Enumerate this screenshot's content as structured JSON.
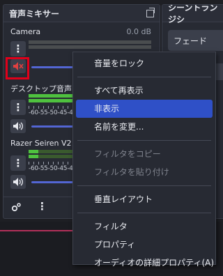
{
  "mixer": {
    "title": "音声ミキサー",
    "channels": [
      {
        "name": "Camera",
        "db": "0.0 dB",
        "muted": true,
        "meter_level": 0.0,
        "volume": 1.0
      },
      {
        "name": "デスクトップ音声",
        "db": "",
        "muted": false,
        "meter_level": 0.55,
        "volume": 1.0,
        "scale": "-60-55-50-45-40"
      },
      {
        "name": "Razer Seiren V2 P",
        "db": "",
        "muted": false,
        "meter_level": 0.08,
        "volume": 1.0,
        "scale": "-60-55-50-45-40"
      }
    ],
    "kebab_glyph": "⋮"
  },
  "transitions": {
    "title": "シーントランジシ",
    "selected": "フェード"
  },
  "context_menu": {
    "items": [
      {
        "label": "音量をロック",
        "enabled": true
      },
      {
        "label": "すべて再表示",
        "enabled": true
      },
      {
        "label": "非表示",
        "enabled": true,
        "selected": true
      },
      {
        "label": "名前を変更...",
        "enabled": true
      },
      {
        "label": "フィルタをコピー",
        "enabled": false
      },
      {
        "label": "フィルタを貼り付け",
        "enabled": false
      },
      {
        "label": "垂直レイアウト",
        "enabled": true
      },
      {
        "label": "フィルタ",
        "enabled": true
      },
      {
        "label": "プロパティ",
        "enabled": true
      },
      {
        "label": "オーディオの詳細プロパティ(A)",
        "enabled": true
      }
    ]
  },
  "colors": {
    "accent": "#2f50c7",
    "slider": "#5366d4",
    "meter_green": "#4fc23f",
    "highlight_red": "#e0001a"
  }
}
